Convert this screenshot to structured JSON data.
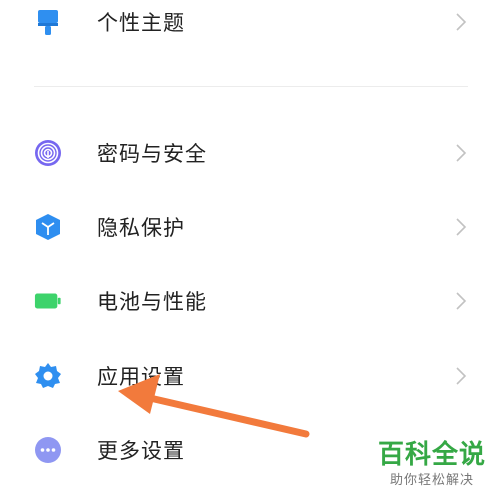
{
  "settings": {
    "items": [
      {
        "id": "theme",
        "label": "个性主题",
        "icon": "paintbrush-icon",
        "icon_color": "#2f8ff0"
      },
      {
        "id": "security",
        "label": "密码与安全",
        "icon": "fingerprint-icon",
        "icon_color": "#7667f0"
      },
      {
        "id": "privacy",
        "label": "隐私保护",
        "icon": "privacy-shield-icon",
        "icon_color": "#2e8ef0"
      },
      {
        "id": "battery",
        "label": "电池与性能",
        "icon": "battery-icon",
        "icon_color": "#3dd36b"
      },
      {
        "id": "apps",
        "label": "应用设置",
        "icon": "gear-icon",
        "icon_color": "#2f8ff0"
      },
      {
        "id": "more",
        "label": "更多设置",
        "icon": "more-dots-icon",
        "icon_color": "#8f97f2"
      }
    ]
  },
  "annotation": {
    "arrow_color": "#f27a3c"
  },
  "watermark": {
    "main": "百科全说",
    "sub": "助你轻松解决",
    "color": "#35a845"
  }
}
